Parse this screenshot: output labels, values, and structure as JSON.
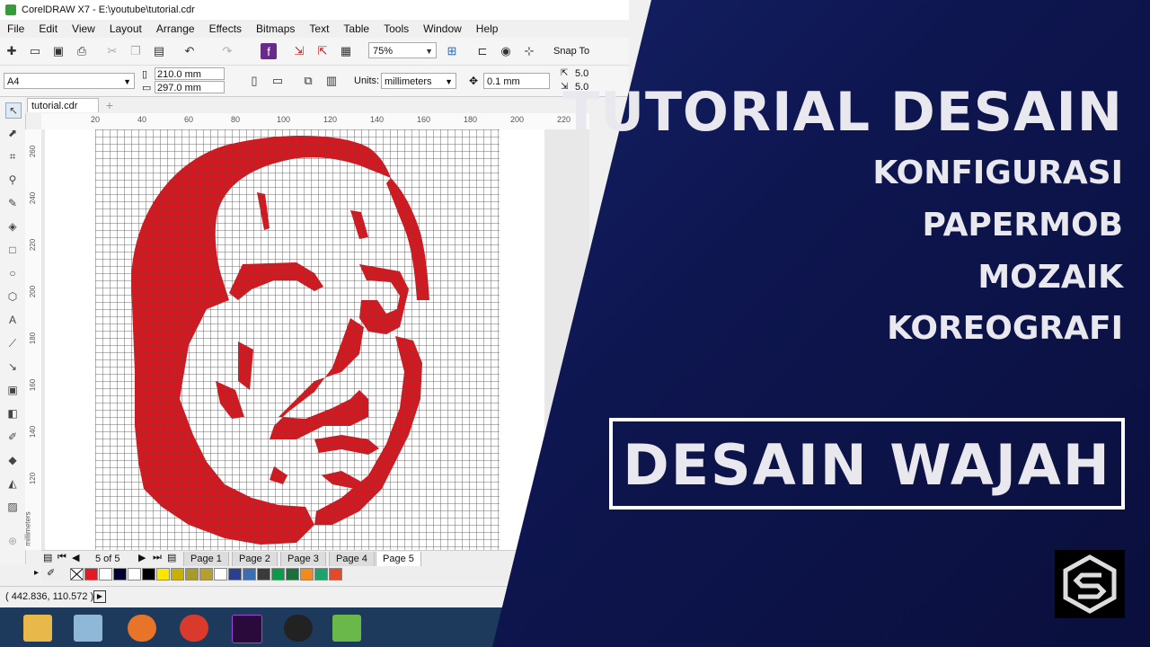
{
  "window": {
    "title": "CorelDRAW X7 - E:\\youtube\\tutorial.cdr"
  },
  "menu": [
    "File",
    "Edit",
    "View",
    "Layout",
    "Arrange",
    "Effects",
    "Bitmaps",
    "Text",
    "Table",
    "Tools",
    "Window",
    "Help"
  ],
  "toolbar": {
    "zoom": "75%",
    "snap_label": "Snap To"
  },
  "property_bar": {
    "page_size": "A4",
    "width": "210.0 mm",
    "height": "297.0 mm",
    "units_label": "Units:",
    "units_value": "millimeters",
    "nudge": "0.1 mm",
    "dup_x": "5.0",
    "dup_y": "5.0"
  },
  "document_tab": "tutorial.cdr",
  "ruler": {
    "h_ticks": [
      "20",
      "40",
      "60",
      "80",
      "100",
      "120",
      "140",
      "160",
      "180",
      "200",
      "220"
    ],
    "v_ticks": [
      "260",
      "240",
      "220",
      "200",
      "180",
      "160",
      "140",
      "120"
    ],
    "unit": "millimeters"
  },
  "page_nav": {
    "counter": "5 of 5",
    "tabs": [
      "Page 1",
      "Page 2",
      "Page 3",
      "Page 4",
      "Page 5"
    ],
    "active": 4
  },
  "palette_colors": [
    "#e21b23",
    "#ffffff",
    "#000033",
    "#ffffff",
    "#000000",
    "#ffe600",
    "#c9b100",
    "#a89a2a",
    "#b5a02e",
    "#ffffff",
    "#2a3f8f",
    "#3b6fb5",
    "#3a3a3a",
    "#0a9a4a",
    "#1c6e3b",
    "#f28b1e",
    "#1aa36a",
    "#e24a2a"
  ],
  "status": {
    "coords": "( 442.836, 110.572 )"
  },
  "mosaic": {
    "fill_color": "#d8161d",
    "grid_color": "#555555"
  },
  "overlay": {
    "title": "TUTORIAL DESAIN",
    "lines": [
      "KONFIGURASI",
      "PAPERMOB",
      "MOZAIK",
      "KOREOGRAFI"
    ],
    "boxed": "DESAIN WAJAH",
    "accent": "#0e1650"
  }
}
